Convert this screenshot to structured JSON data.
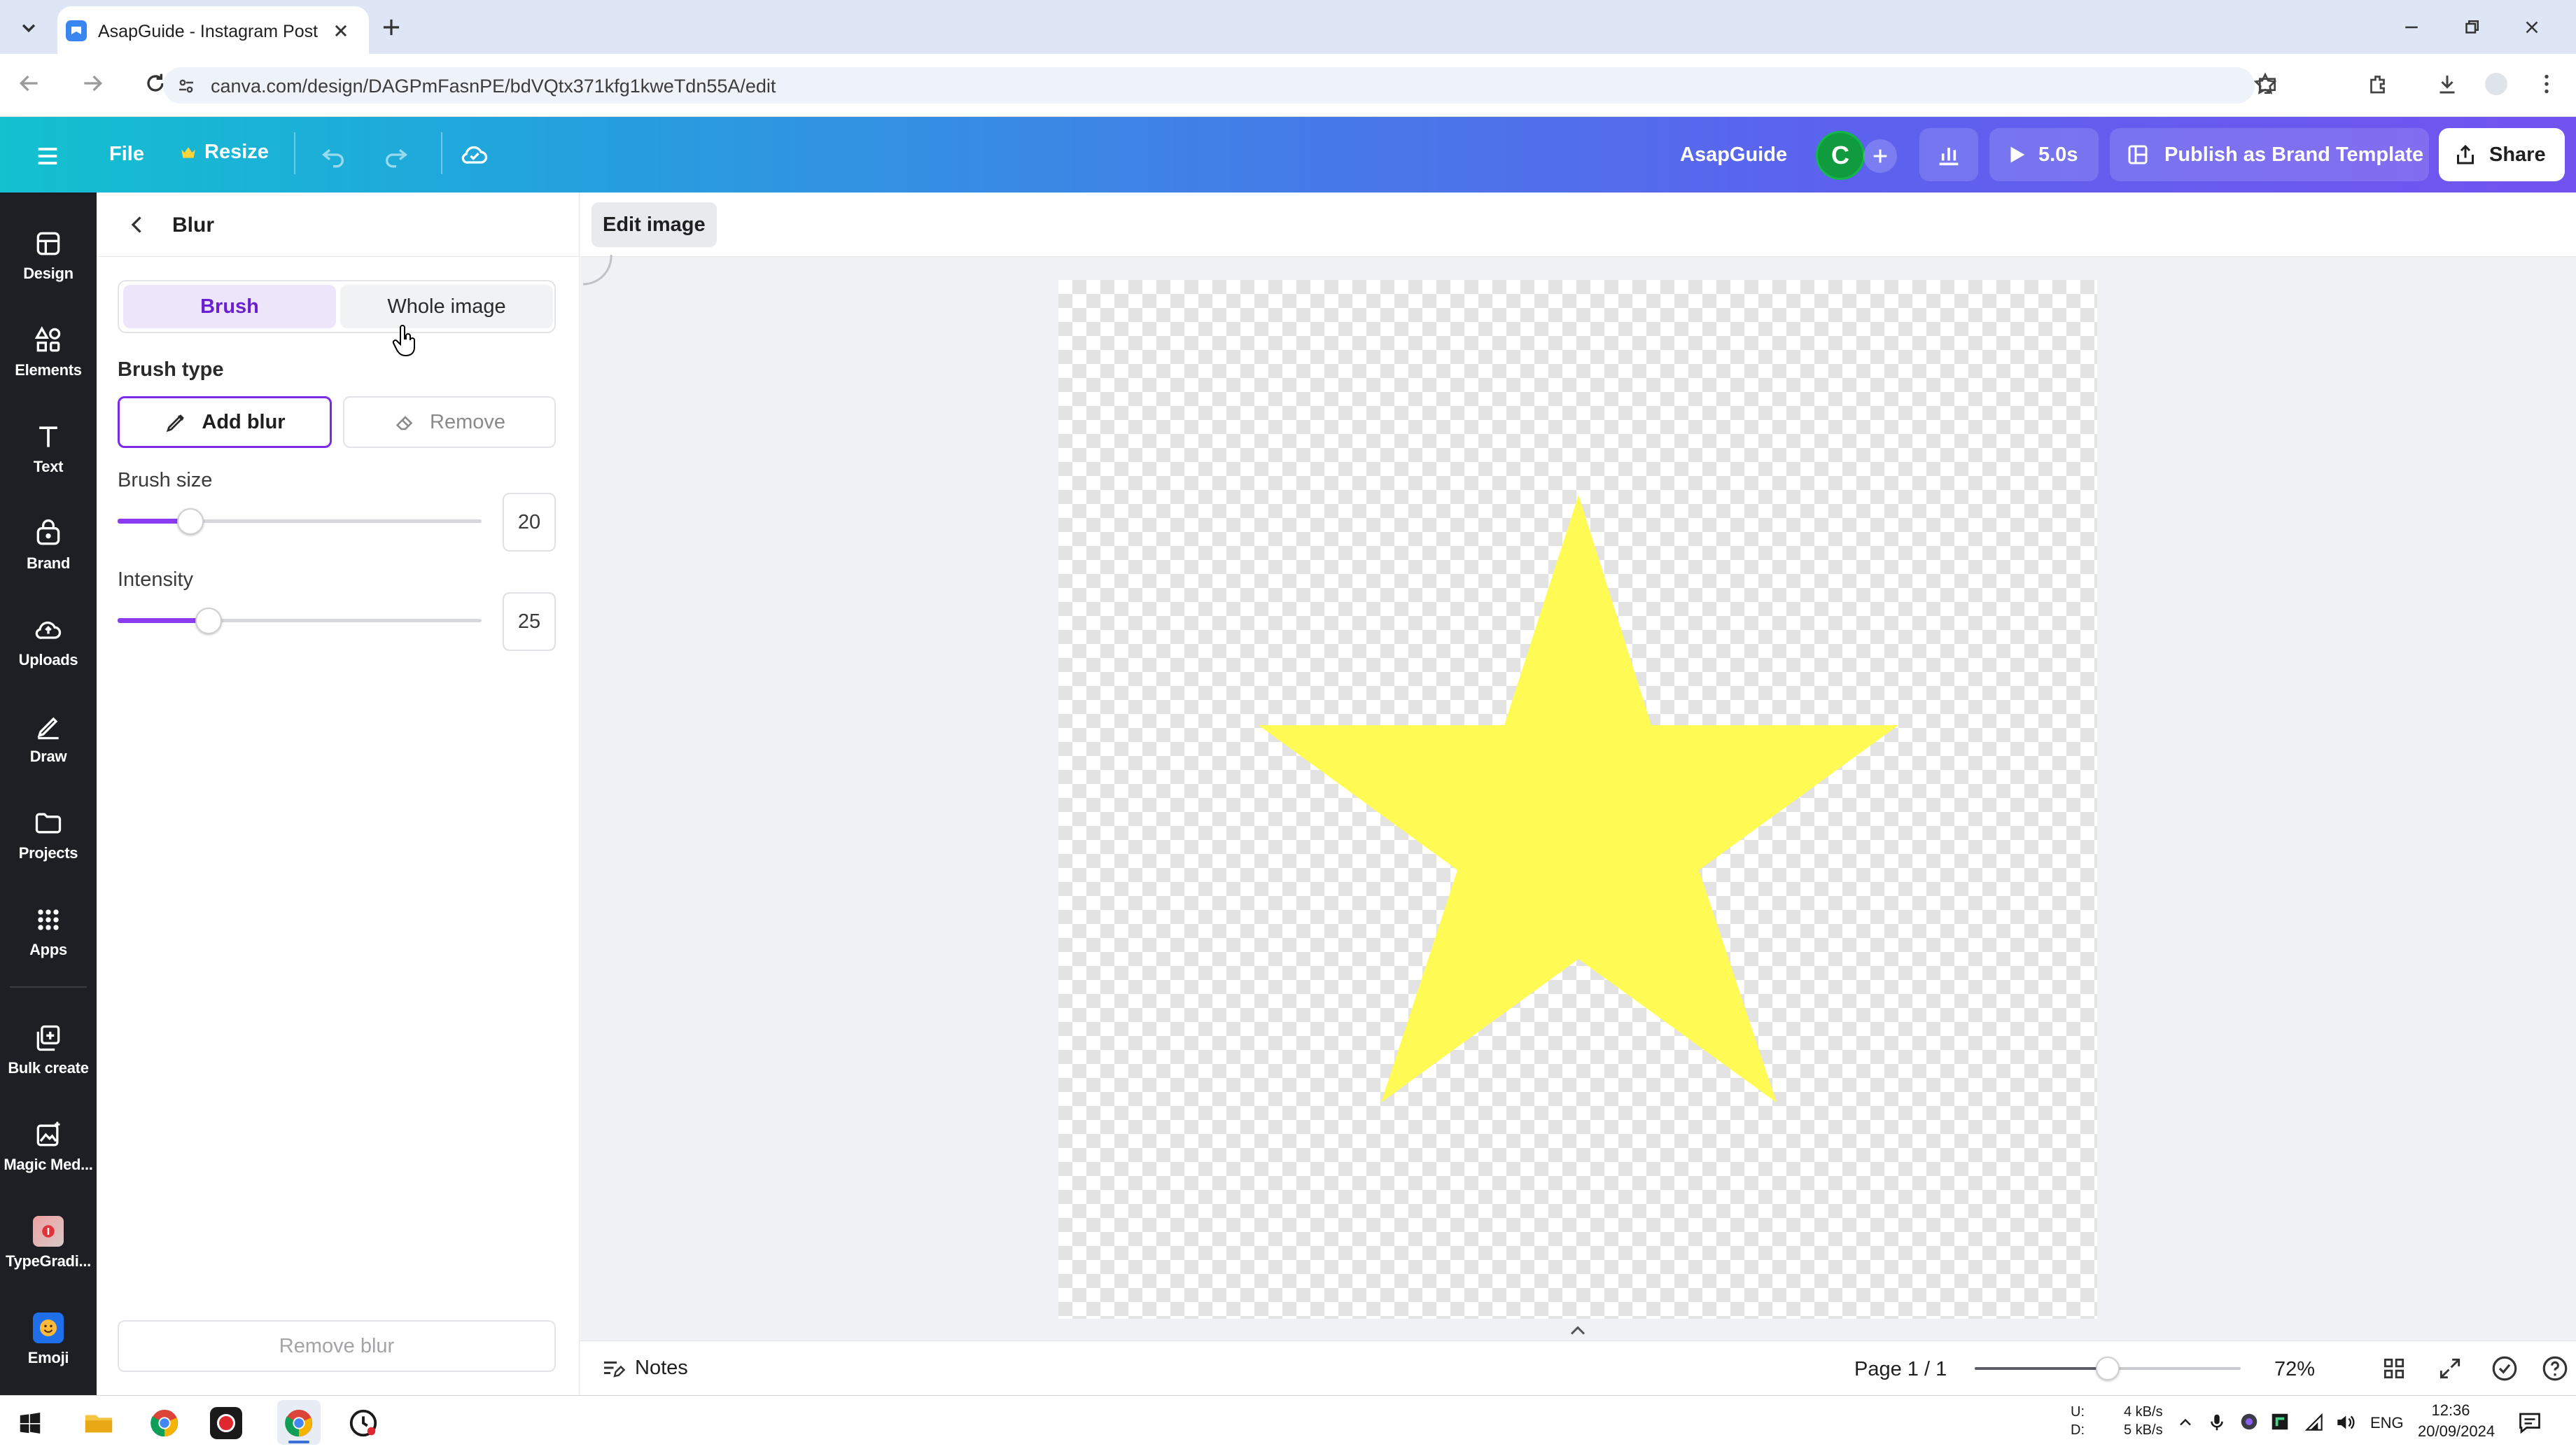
{
  "browser": {
    "tab_title": "AsapGuide - Instagram Post",
    "url": "canva.com/design/DAGPmFasnPE/bdVQtx371kfg1kweTdn55A/edit"
  },
  "header": {
    "file_label": "File",
    "resize_label": "Resize",
    "team_name": "AsapGuide",
    "avatar_initial": "C",
    "play_duration": "5.0s",
    "publish_label": "Publish as Brand Template",
    "share_label": "Share"
  },
  "rail": {
    "items": [
      {
        "label": "Design",
        "icon": "layout-icon"
      },
      {
        "label": "Elements",
        "icon": "shapes-icon"
      },
      {
        "label": "Text",
        "icon": "text-icon"
      },
      {
        "label": "Brand",
        "icon": "brand-icon"
      },
      {
        "label": "Uploads",
        "icon": "cloud-upload-icon"
      },
      {
        "label": "Draw",
        "icon": "pen-icon"
      },
      {
        "label": "Projects",
        "icon": "folder-icon"
      },
      {
        "label": "Apps",
        "icon": "grid-icon"
      },
      {
        "label": "Bulk create",
        "icon": "bulk-create-icon"
      },
      {
        "label": "Magic Med...",
        "icon": "magic-media-icon"
      },
      {
        "label": "TypeGradi...",
        "icon": "typegradient-icon"
      },
      {
        "label": "Emoji",
        "icon": "emoji-icon"
      }
    ]
  },
  "panel": {
    "title": "Blur",
    "mode_tabs": {
      "brush": "Brush",
      "whole_image": "Whole image",
      "selected": "Brush"
    },
    "brush_type_label": "Brush type",
    "add_blur_label": "Add blur",
    "remove_label": "Remove",
    "brush_size_label": "Brush size",
    "brush_size_value": "20",
    "brush_size_fraction": 0.2,
    "intensity_label": "Intensity",
    "intensity_value": "25",
    "intensity_fraction": 0.25,
    "remove_blur_label": "Remove blur"
  },
  "context_bar": {
    "edit_image_label": "Edit image"
  },
  "canvas": {
    "shape": "star",
    "star_color": "#FFFB54"
  },
  "footer": {
    "notes_label": "Notes",
    "page_indicator": "Page 1 / 1",
    "zoom": "72%",
    "zoom_fraction": 0.5
  },
  "taskbar": {
    "net_up_label": "U:",
    "net_down_label": "D:",
    "net_up": "4 kB/s",
    "net_down": "5 kB/s",
    "language": "ENG",
    "time": "12:36",
    "date": "20/09/2024"
  },
  "colors": {
    "accent_purple": "#7d2ae8",
    "selected_tab_bg": "#ede6fb",
    "rail_bg": "#1d1f24"
  }
}
